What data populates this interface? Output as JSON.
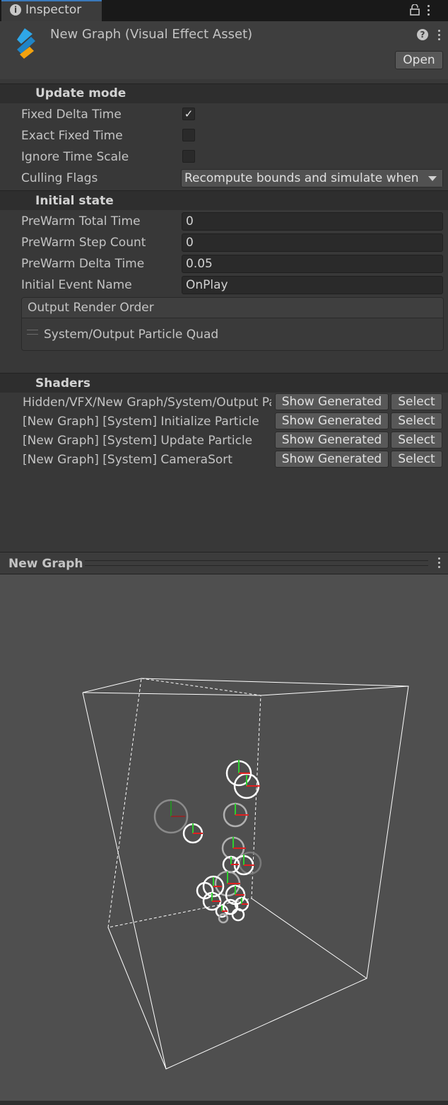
{
  "tab": {
    "label": "Inspector",
    "icon": "info-icon"
  },
  "header": {
    "title": "New Graph (Visual Effect Asset)",
    "open_label": "Open",
    "help_icon": "help-icon",
    "lock_icon": "lock-icon"
  },
  "update_mode": {
    "title": "Update mode",
    "fixed_delta_time": {
      "label": "Fixed Delta Time",
      "checked": true
    },
    "exact_fixed_time": {
      "label": "Exact Fixed Time",
      "checked": false
    },
    "ignore_time_scale": {
      "label": "Ignore Time Scale",
      "checked": false
    },
    "culling_flags": {
      "label": "Culling Flags",
      "value": "Recompute bounds and simulate when visible"
    }
  },
  "initial_state": {
    "title": "Initial state",
    "prewarm_total_time": {
      "label": "PreWarm Total Time",
      "value": "0"
    },
    "prewarm_step_count": {
      "label": "PreWarm Step Count",
      "value": "0"
    },
    "prewarm_delta_time": {
      "label": "PreWarm Delta Time",
      "value": "0.05"
    },
    "initial_event_name": {
      "label": "Initial Event Name",
      "value": "OnPlay"
    },
    "output_render_order": {
      "title": "Output Render Order",
      "items": [
        "System/Output Particle Quad"
      ]
    }
  },
  "shaders": {
    "title": "Shaders",
    "show_label": "Show Generated",
    "select_label": "Select",
    "rows": [
      "Hidden/VFX/New Graph/System/Output Particle Quad",
      "[New Graph] [System] Initialize Particle",
      "[New Graph] [System] Update Particle",
      "[New Graph] [System] CameraSort"
    ]
  },
  "preview": {
    "title": "New Graph"
  }
}
